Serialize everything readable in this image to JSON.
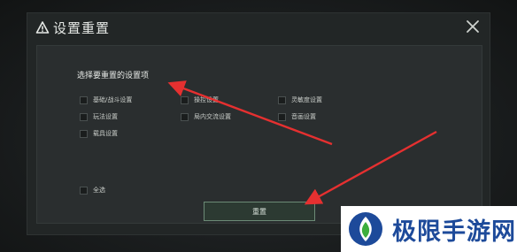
{
  "dialog": {
    "title": "设置重置",
    "section_label": "选择要重置的设置项",
    "options": [
      {
        "label": "基础/战斗设置",
        "checked": false
      },
      {
        "label": "操控设置",
        "checked": false
      },
      {
        "label": "灵敏度设置",
        "checked": false
      },
      {
        "label": "玩法设置",
        "checked": false
      },
      {
        "label": "局内交流设置",
        "checked": false
      },
      {
        "label": "音画设置",
        "checked": false
      },
      {
        "label": "载具设置",
        "checked": false
      }
    ],
    "select_all": {
      "label": "全选",
      "checked": false
    },
    "reset_button": "重置"
  },
  "annotations": {
    "arrow_color": "#e53030"
  },
  "watermark": {
    "text": "极限手游网",
    "color": "#1d4a9a"
  },
  "icons": {
    "title": "warning-triangle-icon",
    "close": "close-icon"
  }
}
